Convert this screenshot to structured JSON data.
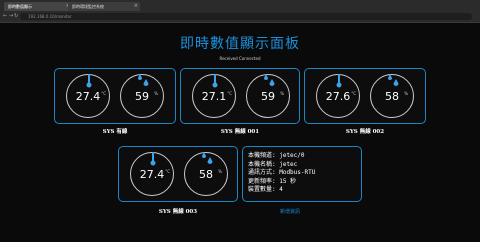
{
  "browser": {
    "tabs": [
      {
        "label": "即時數值顯示"
      },
      {
        "label": "即時環境監控系統"
      }
    ],
    "address": "192.168.0.10/monitor"
  },
  "page": {
    "title": "即時數值顯示面板",
    "status": "Received Connected",
    "more_link": "新增資訊"
  },
  "devices": [
    {
      "label": "SYS 有線",
      "temperature": "27.4",
      "humidity": "59",
      "temp_unit": "°C",
      "hum_unit": "%"
    },
    {
      "label": "SYS 無線 001",
      "temperature": "27.1",
      "humidity": "59",
      "temp_unit": "°C",
      "hum_unit": "%"
    },
    {
      "label": "SYS 無線 002",
      "temperature": "27.6",
      "humidity": "58",
      "temp_unit": "°C",
      "hum_unit": "%"
    },
    {
      "label": "SYS 無線 003",
      "temperature": "27.4",
      "humidity": "58",
      "temp_unit": "°C",
      "hum_unit": "%"
    }
  ],
  "info": {
    "channel": "本機頻道: jetec/0",
    "name": "本機名稱: jetec",
    "method": "通訊方式: Modbus-RTU",
    "rate": "更新頻率: 15 秒",
    "count": "裝置數量: 4"
  },
  "colors": {
    "accent": "#1a8fdc",
    "border": "#1b86c8",
    "background": "#0a0a0a"
  },
  "icons": {
    "temperature": "thermometer-icon",
    "humidity": "water-drops-icon"
  }
}
